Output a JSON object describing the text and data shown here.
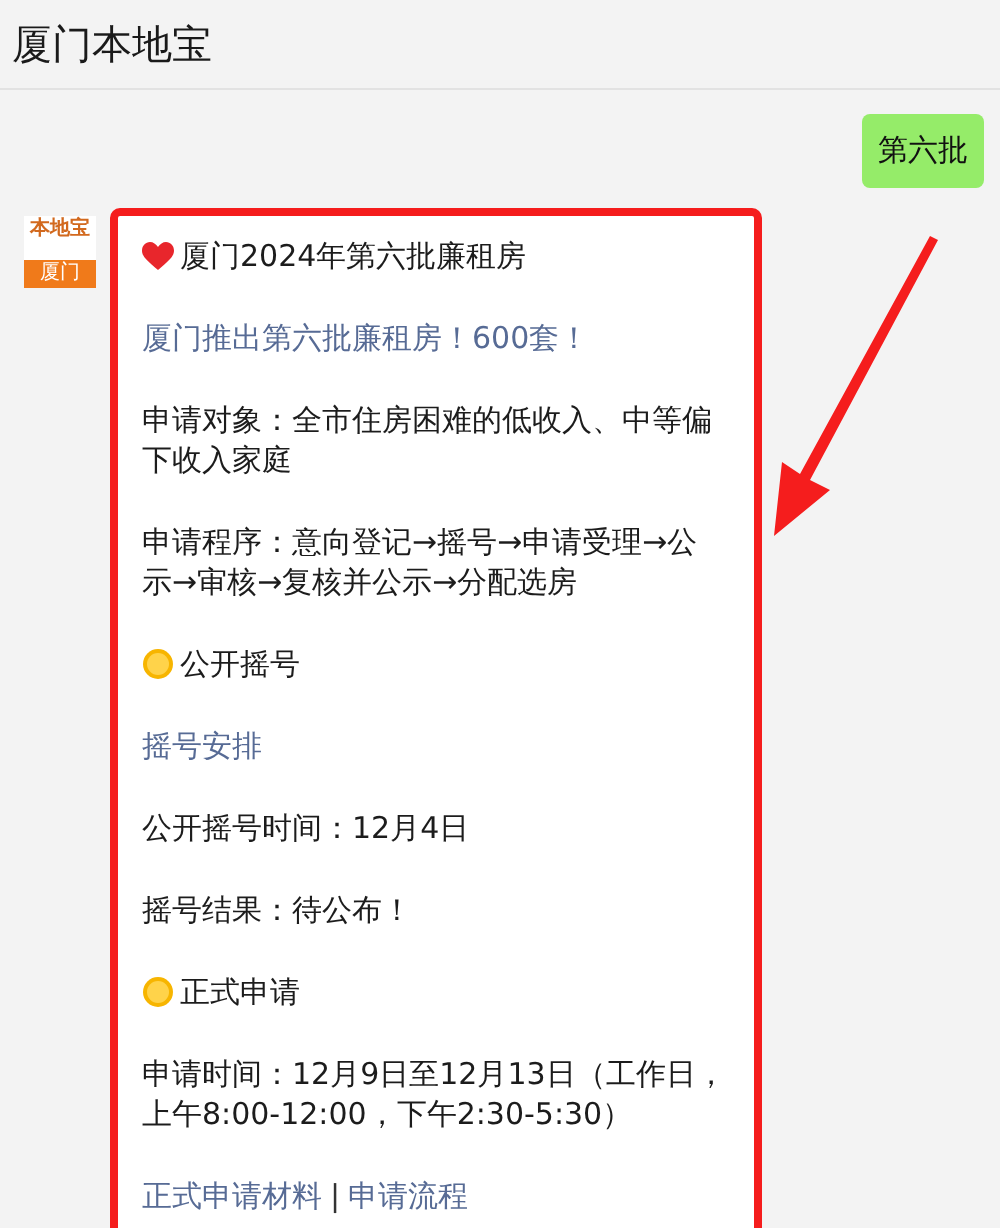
{
  "header": {
    "title": "厦门本地宝"
  },
  "messages": [
    {
      "kind": "sent",
      "text": "第六批"
    },
    {
      "kind": "received",
      "avatar": {
        "brand": "本地宝",
        "city": "厦门"
      },
      "highlighted": true,
      "paragraphs": [
        {
          "kind": "heart-title",
          "lines": [
            "厦门2024年第六批廉租房"
          ]
        },
        {
          "kind": "link",
          "lines": [
            "厦门推出第六批廉租房！600套！"
          ]
        },
        {
          "kind": "text",
          "lines": [
            "申请对象：全市住房困难的低收入、中等偏",
            "下收入家庭"
          ]
        },
        {
          "kind": "text",
          "lines": [
            "申请程序：意向登记→摇号→申请受理→公",
            "示→审核→复核并公示→分配选房"
          ]
        },
        {
          "kind": "sun-title",
          "lines": [
            "公开摇号"
          ]
        },
        {
          "kind": "link",
          "lines": [
            "摇号安排"
          ]
        },
        {
          "kind": "text",
          "lines": [
            "公开摇号时间：12月4日"
          ]
        },
        {
          "kind": "text",
          "lines": [
            "摇号结果：待公布！"
          ]
        },
        {
          "kind": "sun-title",
          "lines": [
            "正式申请"
          ]
        },
        {
          "kind": "text",
          "lines": [
            "申请时间：12月9日至12月13日（工作日，",
            "上午8:00-12:00，下午2:30-5:30）"
          ]
        },
        {
          "kind": "links",
          "links": [
            "正式申请材料",
            "申请流程"
          ],
          "separator": "|"
        }
      ]
    }
  ]
}
